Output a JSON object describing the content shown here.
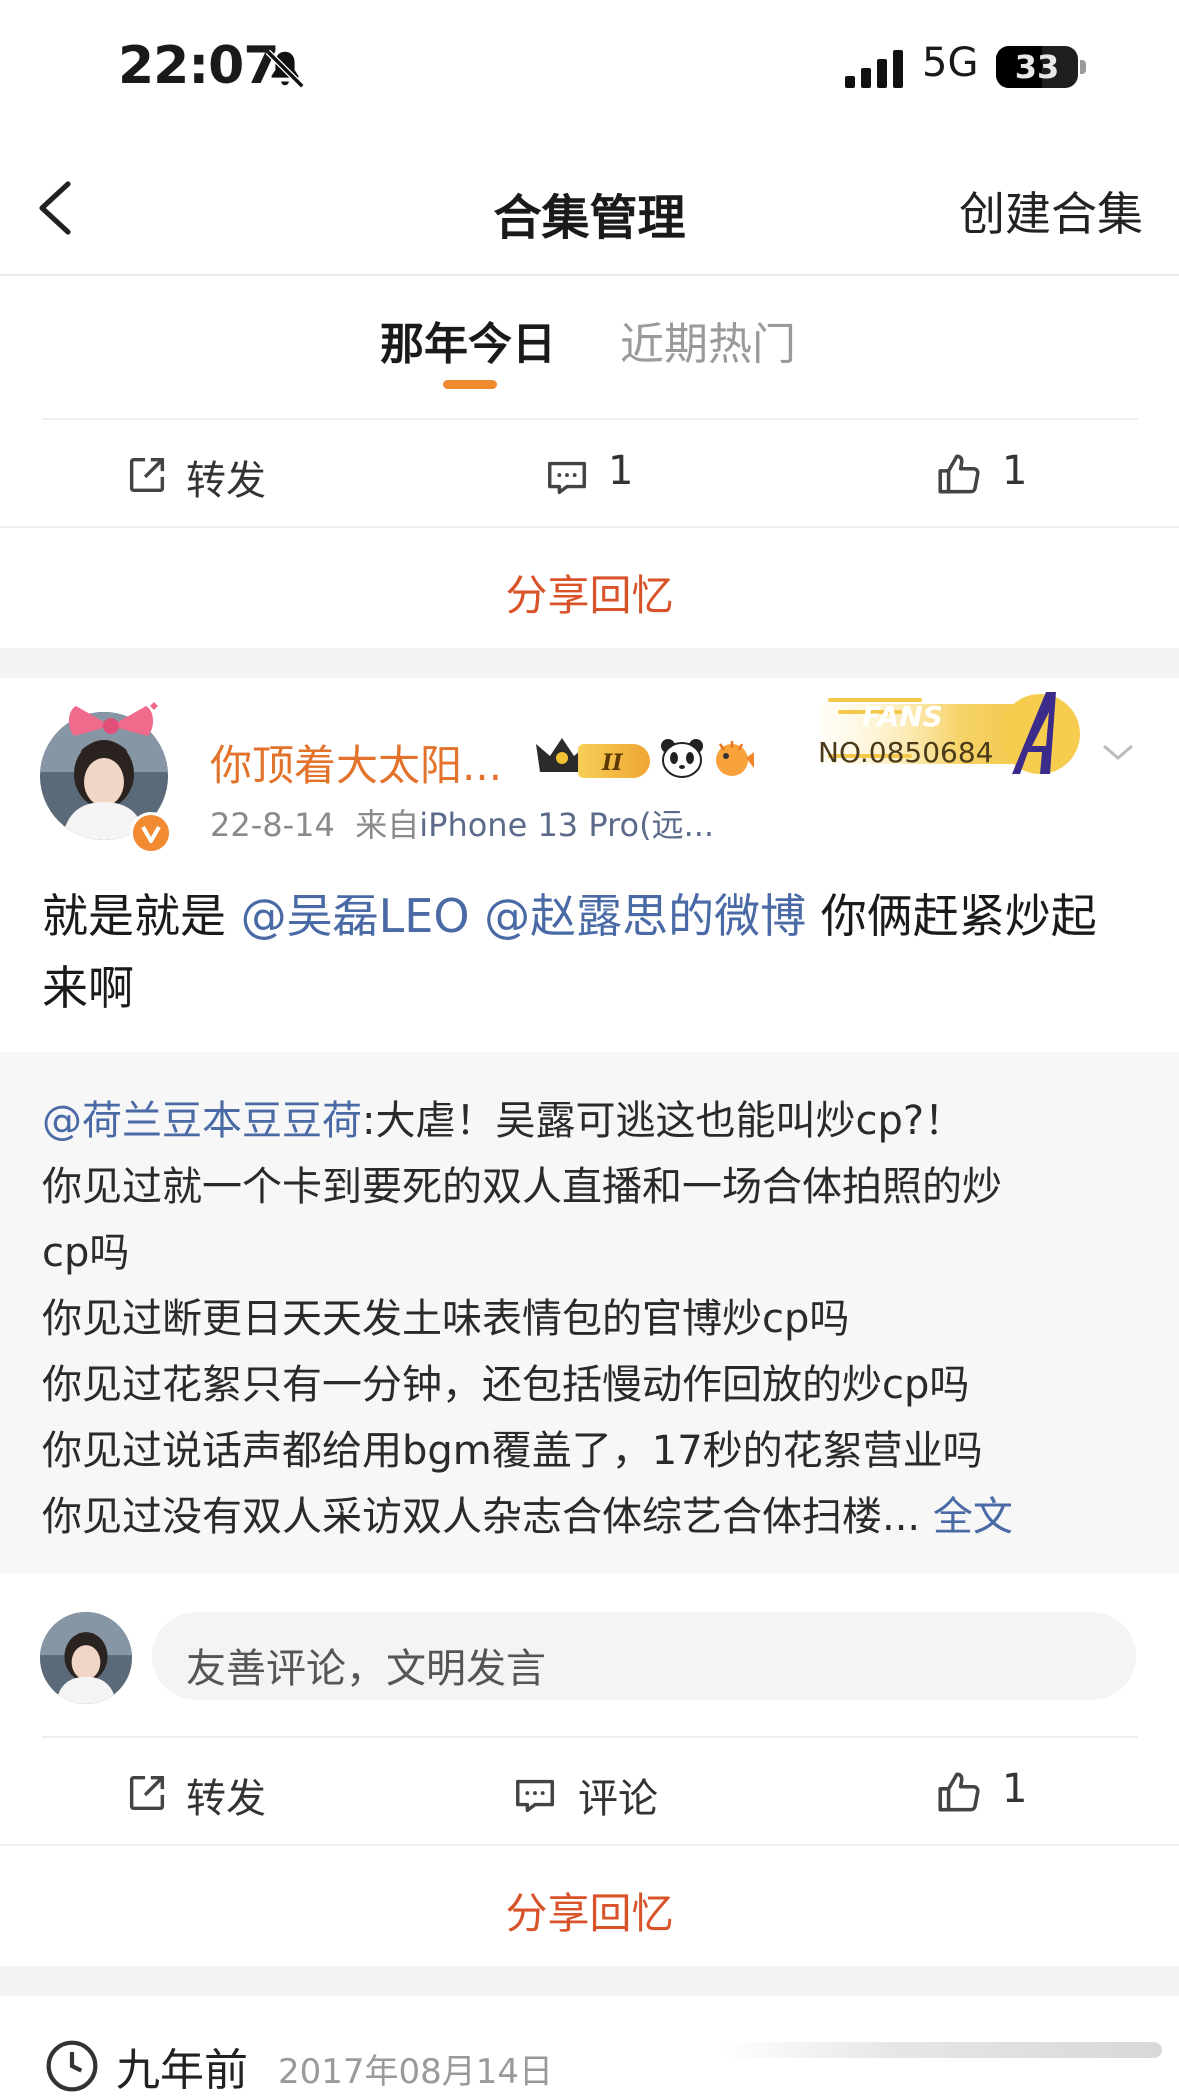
{
  "status_bar": {
    "time": "22:07",
    "network": "5G",
    "battery": "33"
  },
  "header": {
    "title": "合集管理",
    "create_label": "创建合集"
  },
  "tabs": [
    {
      "label": "那年今日",
      "active": true
    },
    {
      "label": "近期热门",
      "active": false
    }
  ],
  "first_card": {
    "repost_label": "转发",
    "comment_count": "1",
    "like_count": "1",
    "share_label": "分享回忆"
  },
  "post": {
    "username": "你顶着大太阳...",
    "badge_number": "NO.0850684",
    "badge_word": "FANS",
    "date": "22-8-14",
    "source_prefix": "来自",
    "source": "iPhone 13 Pro(远...",
    "text_prefix": "就是就是 ",
    "mention_1": "@吴磊LEO",
    "mention_2": "@赵露思的微博",
    "text_suffix_line1": " 你俩赶紧炒起",
    "text_line2": "来啊",
    "quote": {
      "mention": "@荷兰豆本豆豆荷",
      "line1_rest": ":大虐！吴露可逃这也能叫炒cp?！",
      "line2": "你见过就一个卡到要死的双人直播和一场合体拍照的炒",
      "line3": "cp吗",
      "line4": "你见过断更日天天发土味表情包的官博炒cp吗",
      "line5": "你见过花絮只有一分钟，还包括慢动作回放的炒cp吗",
      "line6": "你见过说话声都给用bgm覆盖了，17秒的花絮营业吗",
      "line7": "你见过没有双人采访双人杂志合体综艺合体扫楼...",
      "full_text_label": "全文"
    },
    "comment_placeholder": "友善评论，文明发言",
    "repost_label": "转发",
    "comment_label": "评论",
    "like_count": "1",
    "share_label": "分享回忆"
  },
  "next_section": {
    "years_ago": "九年前",
    "date": "2017年08月14日"
  },
  "colors": {
    "accent_orange": "#ef8a2e",
    "share_red": "#d9532a",
    "mention_blue": "#4a6aa5",
    "username_orange": "#e3722a"
  }
}
